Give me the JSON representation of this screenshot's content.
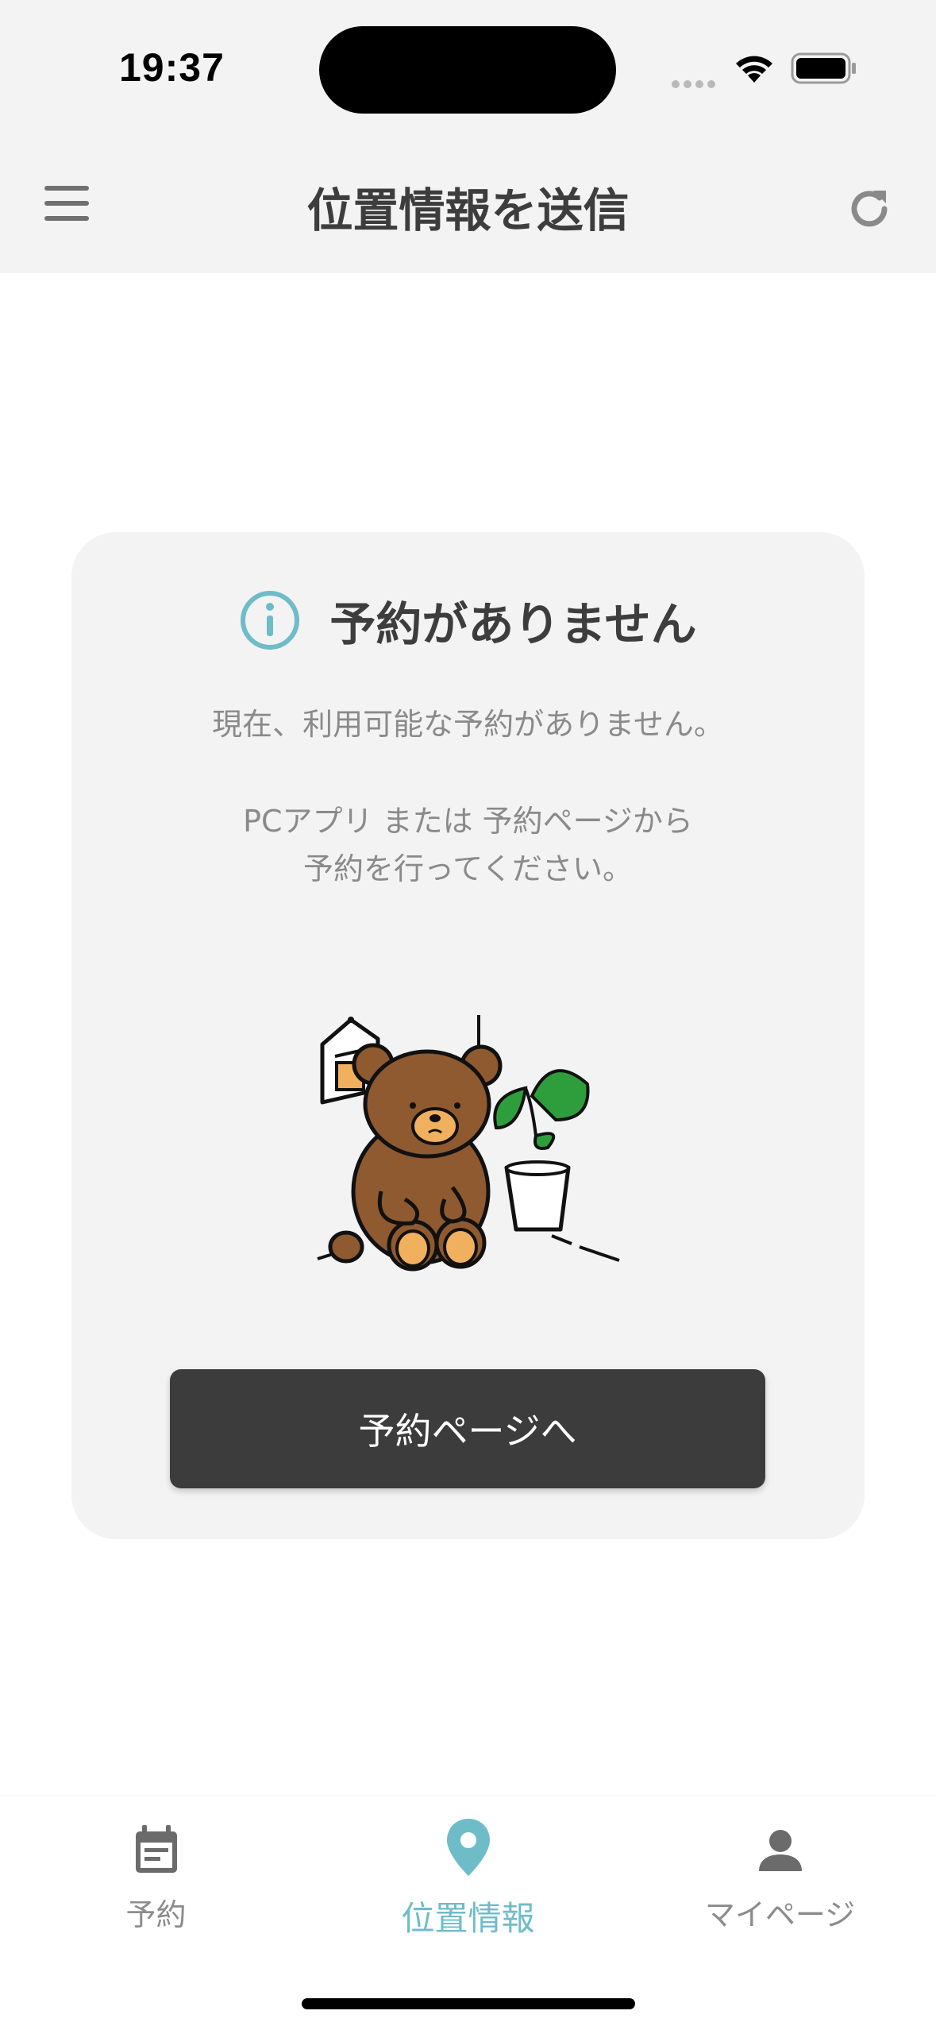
{
  "status_bar": {
    "time": "19:37",
    "wifi_icon": "wifi-icon",
    "battery_icon": "battery-icon"
  },
  "header": {
    "title": "位置情報を送信",
    "menu_icon": "hamburger-menu-icon",
    "refresh_icon": "refresh-icon"
  },
  "empty_state": {
    "icon": "info-icon",
    "title": "予約がありません",
    "message_line1": "現在、利用可能な予約がありません。",
    "message_line2": "PCアプリ または 予約ページから",
    "message_line3": "予約を行ってください。",
    "illustration": "teddy-bear-with-plant-illustration",
    "button_label": "予約ページへ"
  },
  "tab_bar": {
    "active_tab": "位置情報",
    "items": [
      {
        "label": "予約",
        "icon": "calendar-icon"
      },
      {
        "label": "位置情報",
        "icon": "location-pin-icon"
      },
      {
        "label": "マイページ",
        "icon": "person-icon"
      }
    ]
  },
  "colors": {
    "accent": "#6fbcc9",
    "header_bg": "#f3f3f3",
    "card_bg": "#f3f3f3",
    "button_bg": "#3c3c3c",
    "bear": "#8b5a2b",
    "plant": "#2e9e3c"
  }
}
